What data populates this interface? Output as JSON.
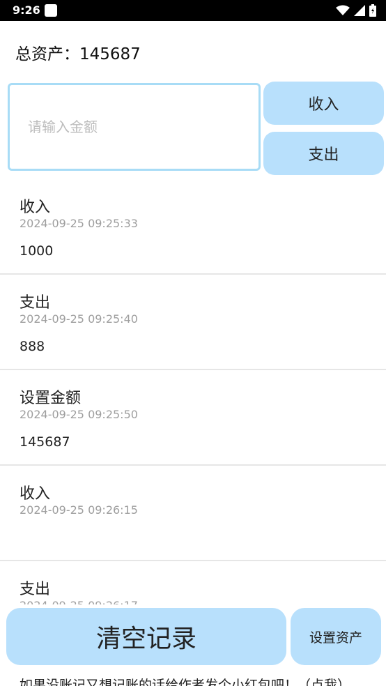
{
  "status_bar": {
    "time": "9:26",
    "icons": [
      "notification-icon",
      "wifi-icon",
      "signal-icon",
      "battery-icon"
    ]
  },
  "header": {
    "total_label": "总资产：",
    "total_value": "145687"
  },
  "input": {
    "placeholder": "请输入金额",
    "value": ""
  },
  "buttons": {
    "income": "收入",
    "expense": "支出",
    "clear": "清空记录",
    "set_assets": "设置资产"
  },
  "records": [
    {
      "type": "收入",
      "time": "2024-09-25 09:25:33",
      "amount": "1000"
    },
    {
      "type": "支出",
      "time": "2024-09-25 09:25:40",
      "amount": "888"
    },
    {
      "type": "设置金额",
      "time": "2024-09-25 09:25:50",
      "amount": "145687"
    },
    {
      "type": "收入",
      "time": "2024-09-25 09:26:15",
      "amount": ""
    },
    {
      "type": "支出",
      "time": "2024-09-25 09:26:17",
      "amount": ""
    }
  ],
  "footer": {
    "tip": "如果没账记又想记账的话给作者发个小红包吧！（点我）"
  },
  "colors": {
    "button_bg": "#b8e0fc",
    "input_border": "#a8dcf6",
    "status_bar": "#000000"
  }
}
